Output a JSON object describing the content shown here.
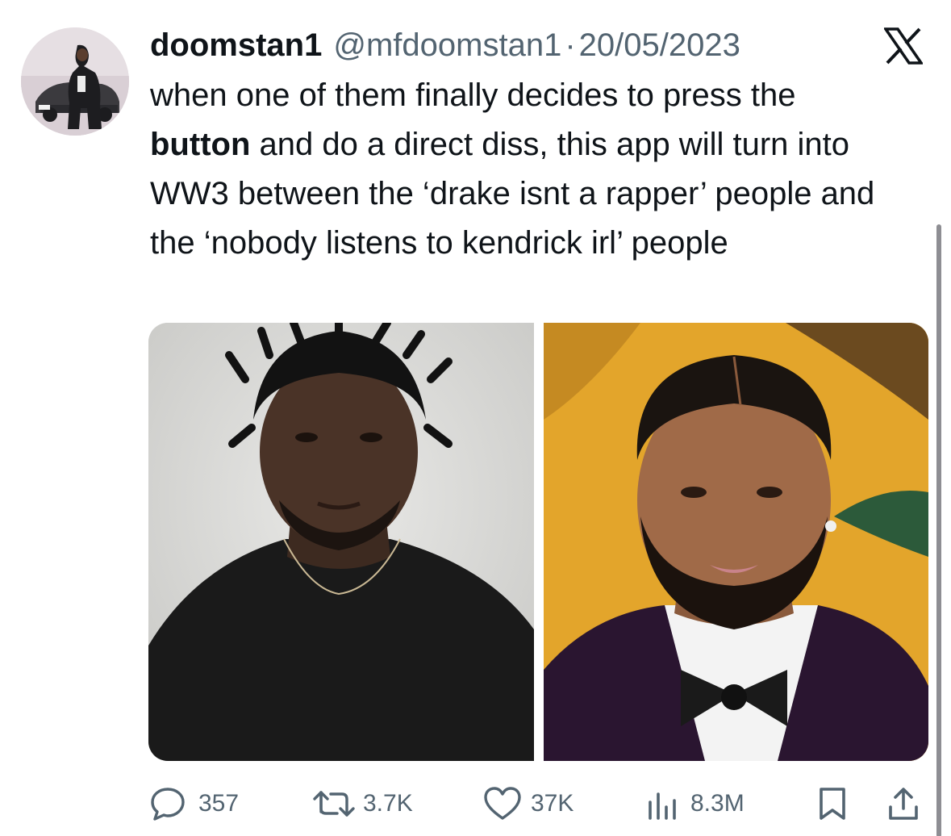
{
  "tweet": {
    "display_name": "doomstan1",
    "handle": "@mfdoomstan1",
    "separator": "·",
    "date": "20/05/2023",
    "text_part1": "when one of them finally decides to press the ",
    "text_bold": "button",
    "text_part2": " and do a direct diss, this app will turn into WW3 between the ‘drake isnt a rapper’ people and the ‘nobody listens to kendrick irl’ people"
  },
  "media": {
    "left_image": "portrait-photo",
    "right_image": "portrait-photo"
  },
  "actions": {
    "replies": "357",
    "reposts": "3.7K",
    "likes": "37K",
    "views": "8.3M"
  },
  "icons": {
    "platform": "x-logo-icon",
    "reply": "reply-icon",
    "repost": "repost-icon",
    "like": "heart-icon",
    "views": "views-icon",
    "bookmark": "bookmark-icon",
    "share": "share-icon"
  },
  "colors": {
    "text": "#0f1419",
    "muted": "#536471",
    "background": "#ffffff"
  }
}
